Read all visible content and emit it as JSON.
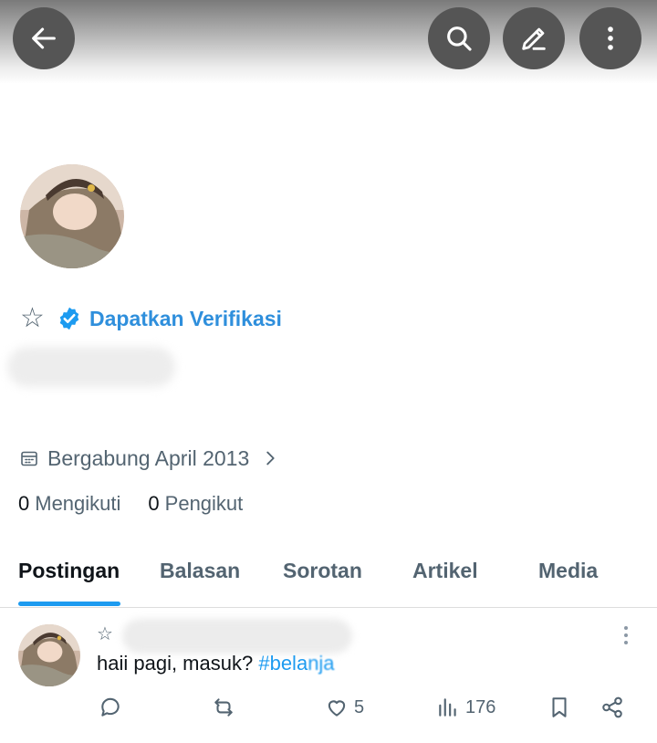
{
  "header": {
    "back_icon": "arrow-left-icon",
    "search_icon": "search-icon",
    "edit_icon": "pencil-icon",
    "more_icon": "more-vertical-icon",
    "button_bg": "#555555"
  },
  "profile": {
    "favorite_icon": "☆",
    "verify_label": "Dapatkan Verifikasi",
    "verify_color": "#2f8fdc",
    "joined": "Bergabung April 2013",
    "following_count": "0",
    "following_label": "Mengikuti",
    "followers_count": "0",
    "followers_label": "Pengikut"
  },
  "tabs": [
    {
      "label": "Postingan",
      "active": true
    },
    {
      "label": "Balasan",
      "active": false
    },
    {
      "label": "Sorotan",
      "active": false
    },
    {
      "label": "Artikel",
      "active": false
    },
    {
      "label": "Media",
      "active": false
    }
  ],
  "post": {
    "star_icon": "☆",
    "text": "haii pagi, masuk?",
    "hashtag": "#bela",
    "hashtag_tail": "nja",
    "likes": "5",
    "views": "176",
    "accent": "#1d9bf0"
  }
}
